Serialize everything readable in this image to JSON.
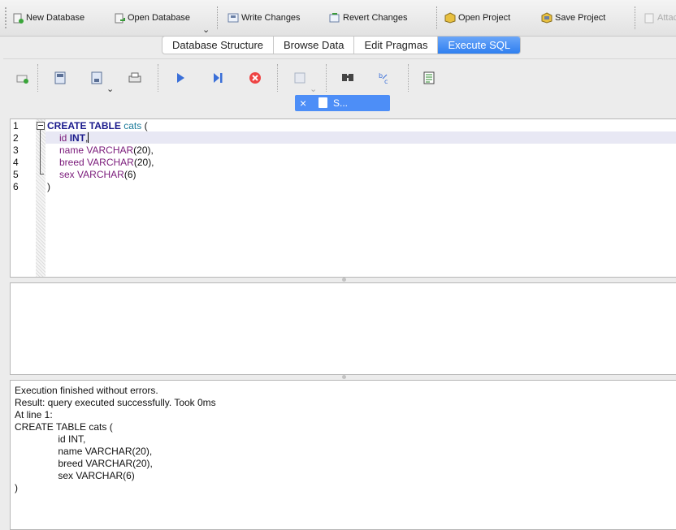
{
  "toolbar": {
    "new_database": "New Database",
    "open_database": "Open Database",
    "write_changes": "Write Changes",
    "revert_changes": "Revert Changes",
    "open_project": "Open Project",
    "save_project": "Save Project",
    "attach": "Attac"
  },
  "tabs": [
    "Database Structure",
    "Browse Data",
    "Edit Pragmas",
    "Execute SQL"
  ],
  "active_tab": "Execute SQL",
  "sql_tab": {
    "close": "×",
    "label": "S..."
  },
  "editor": {
    "line_numbers": [
      "1",
      "2",
      "3",
      "4",
      "5",
      "6"
    ],
    "lines": {
      "l1_kw": "CREATE TABLE",
      "l1_name": "cats",
      "l1_paren": " (",
      "l2_col": "id",
      "l2_type": "INT",
      "l2_end": ",",
      "l3_col": "name",
      "l3_type": "VARCHAR",
      "l3_end": "(20),",
      "l4_col": "breed",
      "l4_type": "VARCHAR",
      "l4_end": "(20),",
      "l5_col": "sex",
      "l5_type": "VARCHAR",
      "l5_end": "(6)",
      "l6": ")"
    }
  },
  "messages": [
    "Execution finished without errors.",
    "Result: query executed successfully. Took 0ms",
    "At line 1:",
    "CREATE TABLE cats (",
    "                id INT,",
    "                name VARCHAR(20),",
    "                breed VARCHAR(20),",
    "                sex VARCHAR(6)",
    ")"
  ],
  "colors": {
    "accent": "#2f7ff0",
    "keyword": "#1a1a8c",
    "table_name": "#1a7a9a",
    "type": "#7a1a7a"
  }
}
